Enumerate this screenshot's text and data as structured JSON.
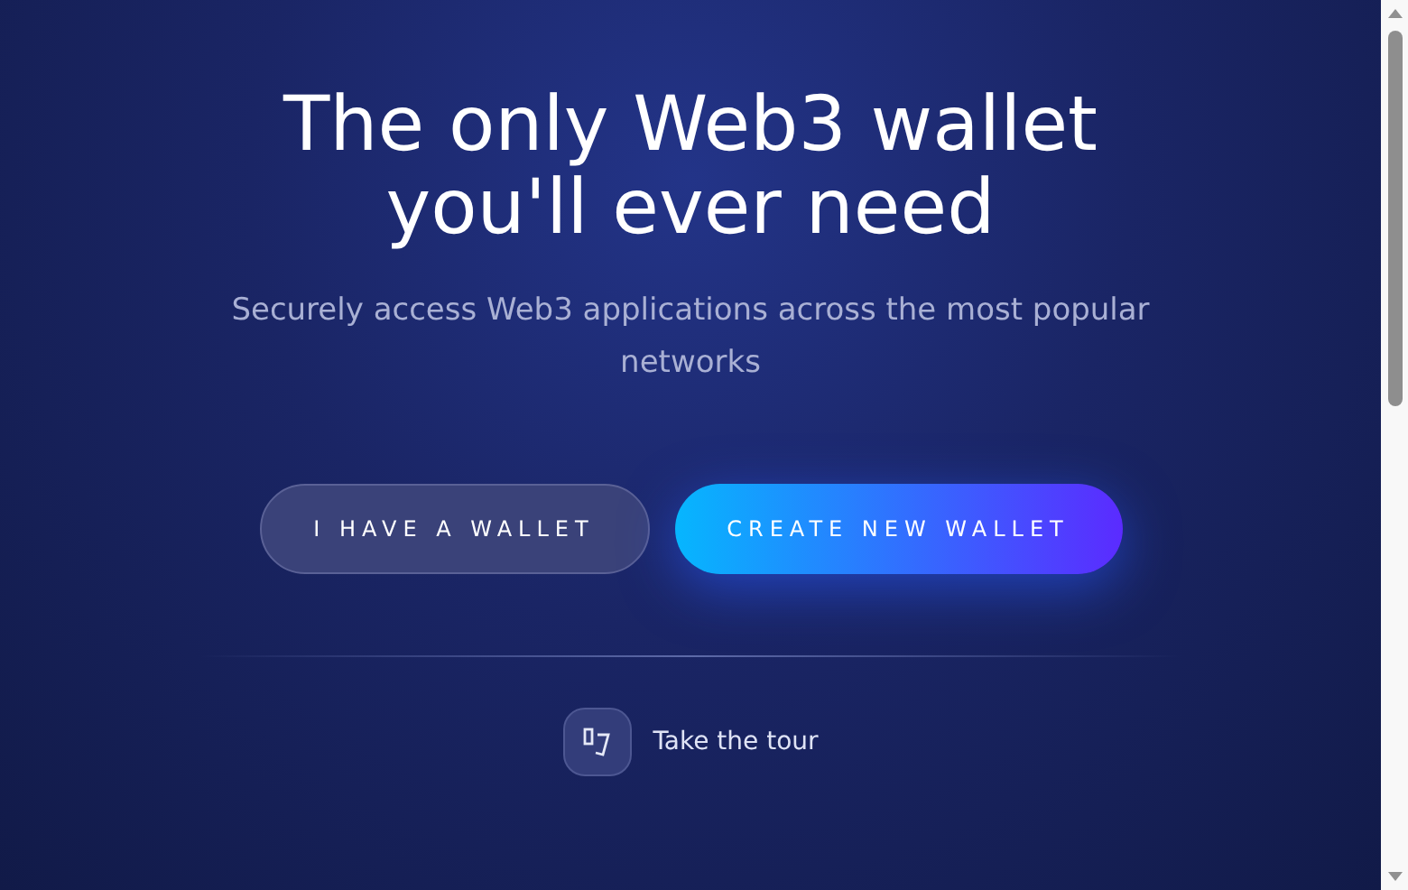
{
  "hero": {
    "title_lines": [
      "The only Web3 wallet",
      "you'll ever need"
    ],
    "subtitle": "Securely access Web3 applications across the most popular networks"
  },
  "buttons": [
    {
      "label": "I HAVE A WALLET",
      "kind": "secondary"
    },
    {
      "label": "CREATE NEW WALLET",
      "kind": "primary"
    }
  ],
  "tour": {
    "label": "Take the tour"
  }
}
